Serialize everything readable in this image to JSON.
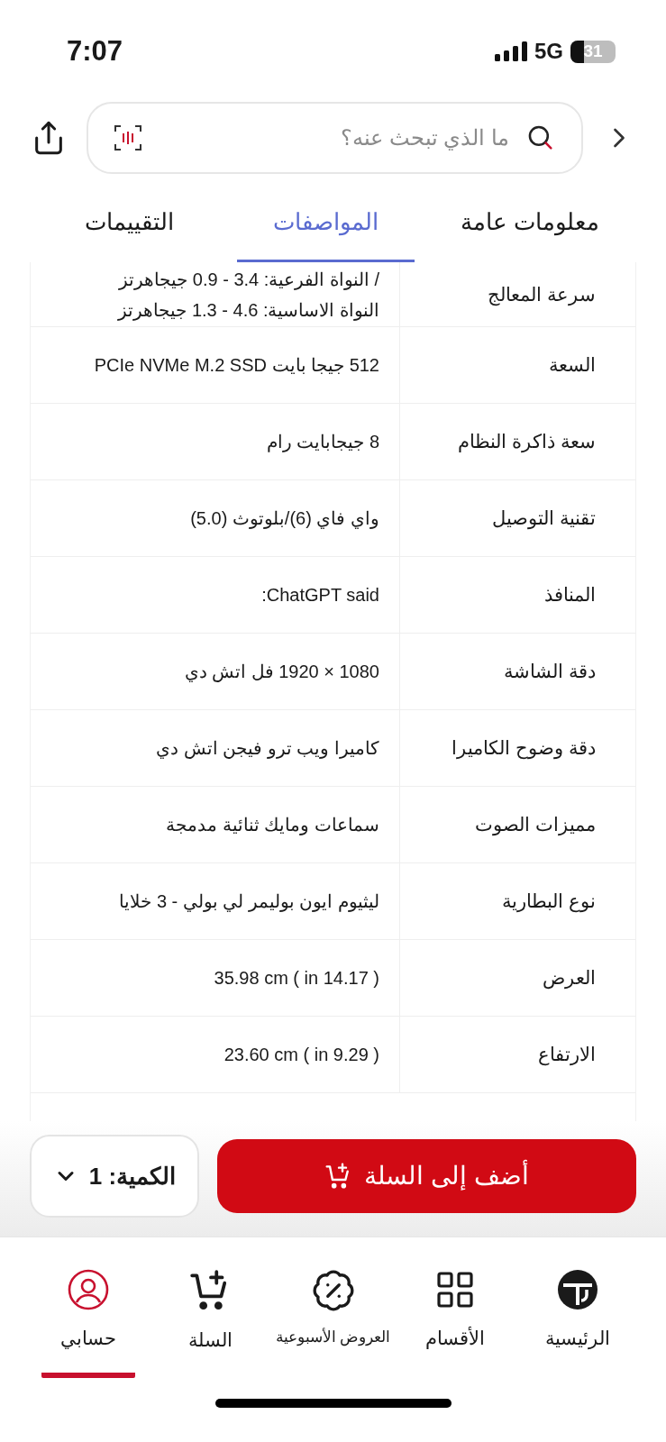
{
  "status_bar": {
    "time": "7:07",
    "network": "5G",
    "battery": "31"
  },
  "search": {
    "placeholder": "ما الذي تبحث عنه؟"
  },
  "tabs": [
    {
      "label": "معلومات عامة",
      "selected": false
    },
    {
      "label": "المواصفات",
      "selected": true
    },
    {
      "label": "التقييمات",
      "selected": false
    }
  ],
  "specs": [
    {
      "name": "سرعة المعالج",
      "lines": [
        "/ النواة الفرعية: 3.4 - 0.9 جيجاهرتز",
        "النواة الاساسية: 4.6 - 1.3 جيجاهرتز"
      ]
    },
    {
      "name": "السعة",
      "lines": [
        "512 جيجا بايت PCIe NVMe M.2 SSD"
      ]
    },
    {
      "name": "سعة ذاكرة النظام",
      "lines": [
        "8 جيجابايت رام"
      ]
    },
    {
      "name": "تقنية التوصيل",
      "lines": [
        "واي فاي (6)/بلوتوث (5.0)"
      ]
    },
    {
      "name": "المنافذ",
      "lines": [
        "ChatGPT said:"
      ]
    },
    {
      "name": "دقة الشاشة",
      "lines": [
        "1080 × 1920 فل اتش دي"
      ]
    },
    {
      "name": "دقة وضوح الكاميرا",
      "lines": [
        "كاميرا ويب ترو فيجن اتش دي"
      ]
    },
    {
      "name": "مميزات الصوت",
      "lines": [
        "سماعات ومايك ثنائية مدمجة"
      ]
    },
    {
      "name": "نوع البطارية",
      "lines": [
        "ليثيوم ايون بوليمر لي بولي - 3 خلايا"
      ]
    },
    {
      "name": "العرض",
      "lines": [
        "( 14.17 in ) 35.98 cm"
      ]
    },
    {
      "name": "الارتفاع",
      "lines": [
        "( 9.29 in ) 23.60 cm"
      ]
    }
  ],
  "add_to_cart": {
    "label": "أضف إلى السلة"
  },
  "quantity": {
    "label": "الكمية: 1"
  },
  "bottom_nav": [
    {
      "kind": "home",
      "label": "الرئيسية",
      "selected": false
    },
    {
      "kind": "categories",
      "label": "الأقسام",
      "selected": false
    },
    {
      "kind": "offers",
      "label": "العروض الأسبوعية",
      "selected": false
    },
    {
      "kind": "cart",
      "label": "السلة",
      "selected": false
    },
    {
      "kind": "account",
      "label": "حسابي",
      "selected": true
    }
  ]
}
